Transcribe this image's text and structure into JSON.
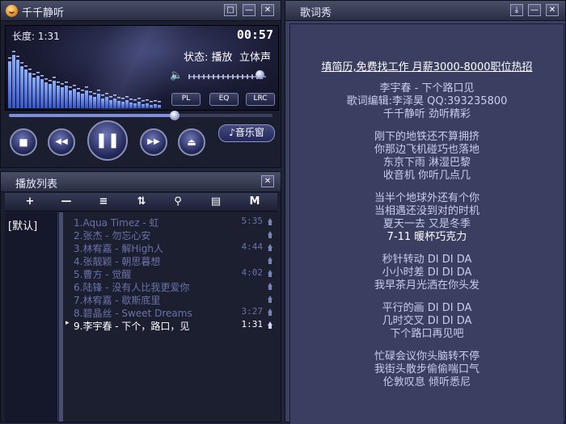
{
  "player": {
    "title": "千千静听",
    "length_label": "长度: 1:31",
    "time": "00:57",
    "status": "状态: 播放",
    "stereo": "立体声",
    "pl_label": "PL",
    "eq_label": "EQ",
    "lrc_label": "LRC",
    "music_window_label": "♪音乐窗",
    "minimode_icon": "□",
    "minimize_icon": "—",
    "close_icon": "✕",
    "volume_icon": "🔈",
    "stop_icon": "■",
    "prev_icon": "◀◀",
    "pause_icon": "❚❚",
    "next_icon": "▶▶",
    "eject_icon": "⏏",
    "seek_progress": 0.63,
    "volume_level": 0.92
  },
  "playlist": {
    "title": "播放列表",
    "close_icon": "✕",
    "tools": [
      "+",
      "—",
      "≡",
      "⇅",
      "⚲",
      "▤",
      "M"
    ],
    "group": "[默认]",
    "current_marker": "▸",
    "items": [
      {
        "name": "1.Aqua Timez - 虹",
        "duration": "5:35"
      },
      {
        "name": "2.张杰 - 勿忘心安",
        "duration": ""
      },
      {
        "name": "3.林宥嘉 - 解High人",
        "duration": "4:44"
      },
      {
        "name": "4.张靓颖 - 朝思暮想",
        "duration": ""
      },
      {
        "name": "5.曹方 - 觉醒",
        "duration": "4:02"
      },
      {
        "name": "6.陆锋 - 没有人比我更爱你",
        "duration": ""
      },
      {
        "name": "7.林宥嘉 - 歇斯底里",
        "duration": ""
      },
      {
        "name": "8.碧晶丝 - Sweet Dreams",
        "duration": "3:27"
      },
      {
        "name": "9.李宇春 - 下个，路口，见",
        "duration": "1:31",
        "current": true
      }
    ]
  },
  "lyrics": {
    "title": "歌词秀",
    "download_icon": "⤓",
    "minimize_icon": "—",
    "close_icon": "✕",
    "ad": "填简历,免费找工作 月薪3000-8000职位热招",
    "lines": [
      "李宇春 - 下个路口见",
      "歌词编辑:李泽昊      QQ:393235800",
      "千千静听 劲听精彩",
      "",
      "刚下的地铁还不算拥挤",
      "你那边飞机碰巧也落地",
      "东京下雨 淋湿巴黎",
      "收音机 你听几点几",
      "",
      "当半个地球外还有个你",
      "当相遇还没到对的时机",
      "夏天一去 又是冬季",
      "7-11 暖杯巧克力",
      "",
      "秒针转动   DI DI DA",
      "小小时差   DI DI DA",
      "我早茶月光洒在你头发",
      "",
      "平行的画   DI DI DA",
      "几时交叉   DI DI DA",
      "下个路口再见吧",
      "",
      "忙碌会议你头脑转不停",
      "我街头散步偷偷喘口气",
      "伦敦叹息 倾听悉尼"
    ],
    "highlight_index": 12
  }
}
